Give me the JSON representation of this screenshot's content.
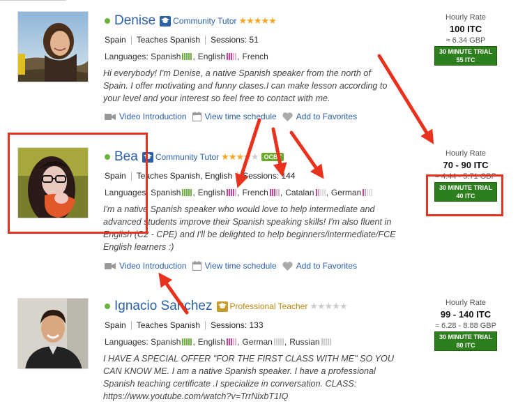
{
  "tutors": [
    {
      "name": "Denise",
      "badge": "Community Tutor",
      "badge_tier": "community",
      "rating_stars": 5,
      "country": "Spain",
      "teaches": "Teaches Spanish",
      "sessions": "Sessions: 51",
      "languages_label": "Languages:",
      "languages": [
        {
          "name": "Spanish",
          "bar_color": "#6cb33e"
        },
        {
          "name": "English",
          "bar_color": "#c0449a"
        },
        {
          "name": "French",
          "bar_color": ""
        }
      ],
      "description": "Hi everybody! I'm Denise, a native Spanish speaker from the north of Spain. I offer motivating and funny clases.I can make lesson according to your level and your interest so feel free to contact with me.",
      "rate_label": "Hourly Rate",
      "rate": "100 ITC",
      "rate_gbp": "≈ 6.34 GBP",
      "trial_line1": "30 MINUTE TRIAL",
      "trial_line2": "55 ITC"
    },
    {
      "name": "Bea",
      "badge": "Community Tutor",
      "badge_tier": "community",
      "rating_stars": 4,
      "extra_badge": "OCBT",
      "country": "Spain",
      "teaches": "Teaches Spanish, English",
      "sessions": "Sessions: 144",
      "languages_label": "Languages:",
      "languages": [
        {
          "name": "Spanish",
          "bar_color": "#6cb33e"
        },
        {
          "name": "English",
          "bar_color": "#c0449a"
        },
        {
          "name": "French",
          "bar_color": "#c0449a"
        },
        {
          "name": "Catalan",
          "bar_color": "#c9a0bd"
        },
        {
          "name": "German",
          "bar_color": "#c9a0bd"
        }
      ],
      "description": "I'm a native Spanish speaker who would love to help intermediate and advanced students improve their Spanish speaking skills! I'm also fluent in English (C2 - CPE) and I'll be delighted to help beginners/intermediate/FCE English learners :)",
      "rate_label": "Hourly Rate",
      "rate": "70 - 90 ITC",
      "rate_gbp": "≈ 4.44 - 5.71 GBP",
      "trial_line1": "30 MINUTE TRIAL",
      "trial_line2": "40 ITC"
    },
    {
      "name": "Ignacio Sanchez",
      "badge": "Professional Teacher",
      "badge_tier": "pro",
      "rating_stars": 0,
      "country": "Spain",
      "teaches": "Teaches Spanish",
      "sessions": "Sessions: 133",
      "languages_label": "Languages:",
      "languages": [
        {
          "name": "Spanish",
          "bar_color": "#6cb33e"
        },
        {
          "name": "English",
          "bar_color": "#c0449a"
        },
        {
          "name": "German",
          "bar_color": "#cccccc"
        },
        {
          "name": "Russian",
          "bar_color": "#cccccc"
        }
      ],
      "description": "I HAVE A SPECIAL OFFER \"FOR THE FIRST CLASS WITH ME\" SO YOU CAN KNOW ME. I am a native Spanish speaker. I have a professional Spanish teaching certificate .I specialize in conversation. CLASS: https://www.youtube.com/watch?v=TrrNixbT1IQ",
      "rate_label": "Hourly Rate",
      "rate": "99 - 140 ITC",
      "rate_gbp": "≈ 6.28 - 8.88 GBP",
      "trial_line1": "30 MINUTE TRIAL",
      "trial_line2": "80 ITC"
    }
  ],
  "actions": {
    "video": "Video Introduction",
    "schedule": "View time schedule",
    "favorites": "Add to Favorites"
  },
  "icons": {
    "online": "online-dot",
    "badge": "graduation-cap-icon",
    "video": "video-camera-icon",
    "schedule": "calendar-icon",
    "favorites": "heart-icon"
  },
  "colors": {
    "link": "#2b5fa8",
    "online": "#6cb33e",
    "trial_bg": "#2d7f1e",
    "annotation": "#e8321e",
    "star": "#f5a623"
  }
}
